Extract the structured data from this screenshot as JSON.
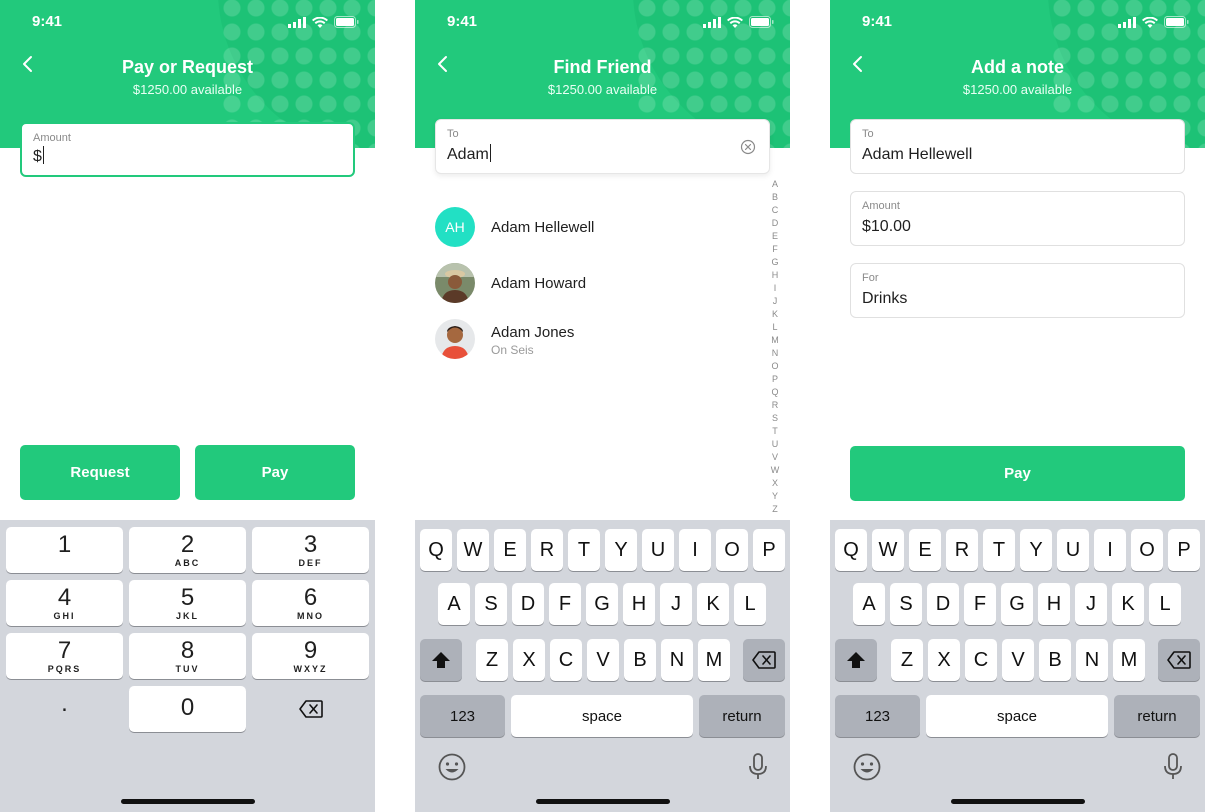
{
  "status": {
    "time": "9:41"
  },
  "colors": {
    "brand_green": "#22c97c",
    "avatar_teal": "#22e0c4",
    "keyboard_bg": "#d3d6dc"
  },
  "screen1": {
    "title": "Pay or Request",
    "subtitle": "$1250.00 available",
    "amount": {
      "label": "Amount",
      "value": "$"
    },
    "buttons": {
      "request": "Request",
      "pay": "Pay"
    },
    "keypad": [
      {
        "num": "1",
        "letters": ""
      },
      {
        "num": "2",
        "letters": "ABC"
      },
      {
        "num": "3",
        "letters": "DEF"
      },
      {
        "num": "4",
        "letters": "GHI"
      },
      {
        "num": "5",
        "letters": "JKL"
      },
      {
        "num": "6",
        "letters": "MNO"
      },
      {
        "num": "7",
        "letters": "PQRS"
      },
      {
        "num": "8",
        "letters": "TUV"
      },
      {
        "num": "9",
        "letters": "WXYZ"
      },
      {
        "num": ".",
        "letters": ""
      },
      {
        "num": "0",
        "letters": ""
      }
    ]
  },
  "screen2": {
    "title": "Find Friend",
    "subtitle": "$1250.00 available",
    "search": {
      "label": "To",
      "value": "Adam"
    },
    "contacts": [
      {
        "name": "Adam Hellewell",
        "initials": "AH",
        "sub": ""
      },
      {
        "name": "Adam Howard",
        "initials": "",
        "sub": ""
      },
      {
        "name": "Adam Jones",
        "initials": "",
        "sub": "On Seis"
      }
    ],
    "index": [
      "A",
      "B",
      "C",
      "D",
      "E",
      "F",
      "G",
      "H",
      "I",
      "J",
      "K",
      "L",
      "M",
      "N",
      "O",
      "P",
      "Q",
      "R",
      "S",
      "T",
      "U",
      "V",
      "W",
      "X",
      "Y",
      "Z"
    ]
  },
  "screen3": {
    "title": "Add a note",
    "subtitle": "$1250.00 available",
    "to": {
      "label": "To",
      "value": "Adam Hellewell"
    },
    "amount": {
      "label": "Amount",
      "value": "$10.00"
    },
    "for": {
      "label": "For",
      "value": "Drinks"
    },
    "pay": "Pay"
  },
  "keyboard": {
    "row1": [
      "Q",
      "W",
      "E",
      "R",
      "T",
      "Y",
      "U",
      "I",
      "O",
      "P"
    ],
    "row2": [
      "A",
      "S",
      "D",
      "F",
      "G",
      "H",
      "J",
      "K",
      "L"
    ],
    "row3": [
      "Z",
      "X",
      "C",
      "V",
      "B",
      "N",
      "M"
    ],
    "numbers_key": "123",
    "space_key": "space",
    "return_key": "return"
  }
}
